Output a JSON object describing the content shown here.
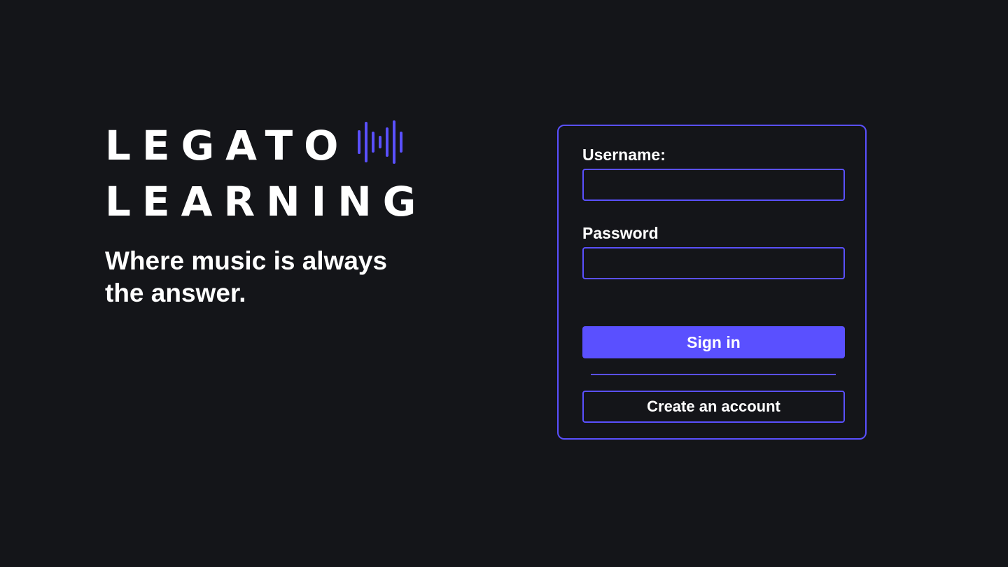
{
  "brand": {
    "logo_line1": "LEGATO",
    "logo_line2": "LEARNING",
    "logo_icon": "sound-wave-icon",
    "tagline": "Where music is always the answer."
  },
  "login_form": {
    "username_label": "Username:",
    "username_value": "",
    "password_label": "Password",
    "password_value": "",
    "sign_in_label": "Sign in",
    "create_account_label": "Create an account"
  },
  "colors": {
    "background": "#141519",
    "accent": "#5a50ff",
    "text": "#ffffff"
  }
}
